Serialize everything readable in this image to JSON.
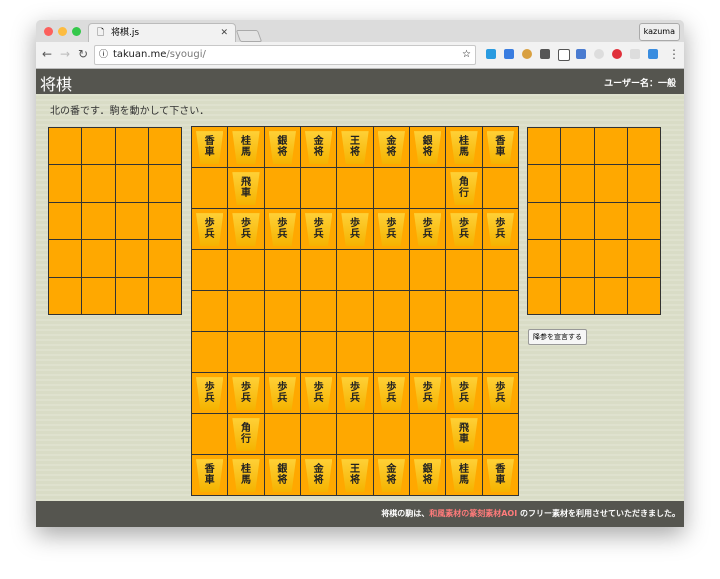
{
  "browser": {
    "tab_title": "将棋.js",
    "profile": "kazuma",
    "url_host": "takuan.me",
    "url_path": "/syougi/"
  },
  "header": {
    "title": "将棋",
    "user": "ユーザー名：一般"
  },
  "message": "北の番です．駒を動かして下さい．",
  "resign_button": "降参を宣言する",
  "footer": {
    "before": "将棋の駒は、",
    "link": "和風素材の篆刻素材AOI",
    "after": " のフリー素材を利用させていただきました。"
  },
  "board": [
    [
      "香車",
      "桂馬",
      "銀将",
      "金将",
      "王将",
      "金将",
      "銀将",
      "桂馬",
      "香車"
    ],
    [
      "",
      "飛車",
      "",
      "",
      "",
      "",
      "",
      "角行",
      ""
    ],
    [
      "歩兵",
      "歩兵",
      "歩兵",
      "歩兵",
      "歩兵",
      "歩兵",
      "歩兵",
      "歩兵",
      "歩兵"
    ],
    [
      "",
      "",
      "",
      "",
      "",
      "",
      "",
      "",
      ""
    ],
    [
      "",
      "",
      "",
      "",
      "",
      "",
      "",
      "",
      ""
    ],
    [
      "",
      "",
      "",
      "",
      "",
      "",
      "",
      "",
      ""
    ],
    [
      "歩兵",
      "歩兵",
      "歩兵",
      "歩兵",
      "歩兵",
      "歩兵",
      "歩兵",
      "歩兵",
      "歩兵"
    ],
    [
      "",
      "角行",
      "",
      "",
      "",
      "",
      "",
      "飛車",
      ""
    ],
    [
      "香車",
      "桂馬",
      "銀将",
      "金将",
      "王将",
      "金将",
      "銀将",
      "桂馬",
      "香車"
    ]
  ],
  "captured_north": [],
  "captured_south": []
}
